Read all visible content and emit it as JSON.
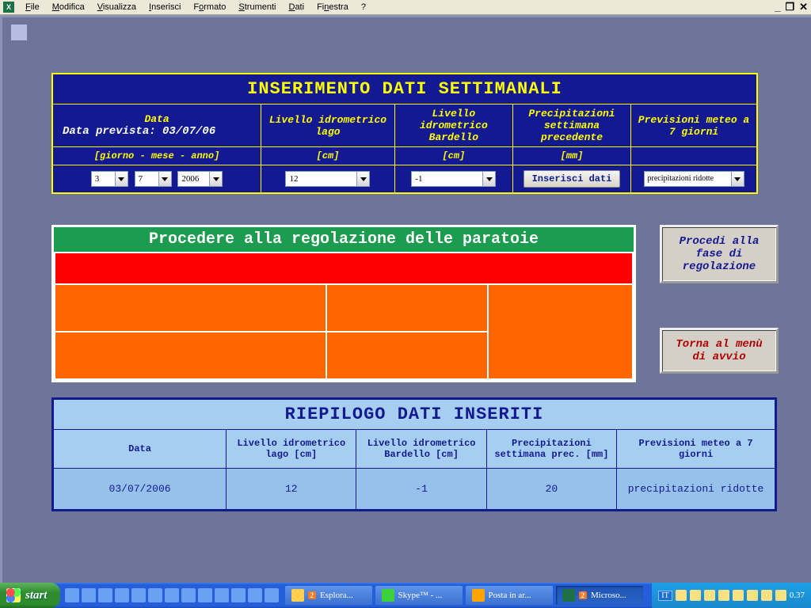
{
  "menu": {
    "file": "File",
    "mod": "Modifica",
    "vis": "Visualizza",
    "ins": "Inserisci",
    "form": "Formato",
    "stru": "Strumenti",
    "dati": "Dati",
    "fin": "Finestra",
    "help": "?"
  },
  "insert": {
    "title": "INSERIMENTO DATI SETTIMANALI",
    "hdr": {
      "data": "Data",
      "lago": "Livello idrometrico lago",
      "bard": "Livello idrometrico Bardello",
      "prec": "Precipitazioni settimana precedente",
      "meteo": "Previsioni meteo a 7 giorni"
    },
    "date_sub": "Data prevista: 03/07/06",
    "unit": {
      "dma": "[giorno - mese - anno]",
      "cm1": "[cm]",
      "cm2": "[cm]",
      "mm": "[mm]"
    },
    "val": {
      "gg": "3",
      "mm": "7",
      "aa": "2006",
      "lago": "12",
      "bard": "-1",
      "btn": "Inserisci dati",
      "meteo": "precipitazioni ridotte"
    }
  },
  "status": {
    "title": "Procedere alla regolazione delle paratoie",
    "btn1": "Procedi alla fase di regolazione",
    "btn2": "Torna al menù di avvio"
  },
  "riep": {
    "title": "RIEPILOGO DATI INSERITI",
    "hdr": {
      "data": "Data",
      "lago": "Livello idrometrico lago [cm]",
      "bard": "Livello idrometrico Bardello [cm]",
      "prec": "Precipitazioni settimana prec. [mm]",
      "meteo": "Previsioni meteo a 7 giorni"
    },
    "row": {
      "data": "03/07/2006",
      "lago": "12",
      "bard": "-1",
      "prec": "20",
      "meteo": "precipitazioni ridotte"
    }
  },
  "taskbar": {
    "start": "start",
    "tasks": {
      "exp": "Esplora...",
      "sky": "Skype™ - ...",
      "mail": "Posta in ar...",
      "xls": "Microso..."
    },
    "badge": "2",
    "lang": "IT",
    "clock": "0.37"
  }
}
